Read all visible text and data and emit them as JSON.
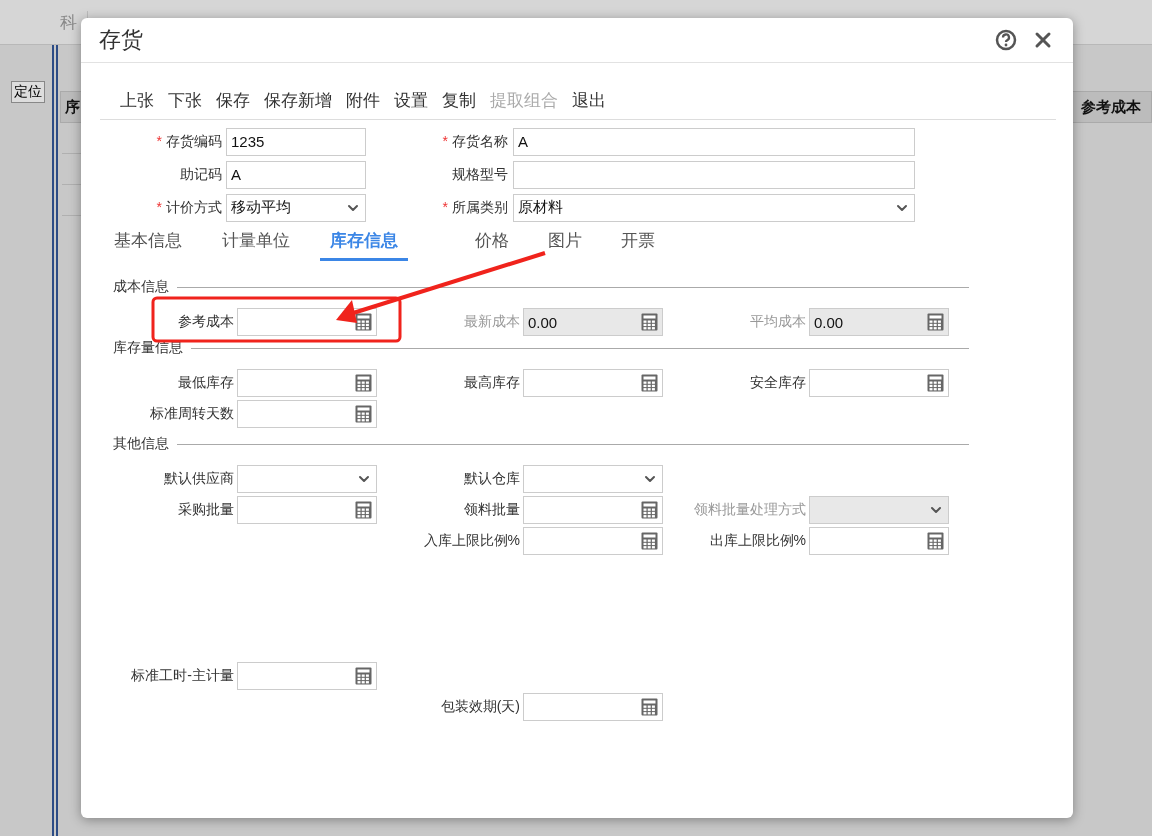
{
  "background_app": {
    "tabs": [
      "科"
    ],
    "locate_button": "定位",
    "table_columns": [
      "序",
      "参考成本"
    ]
  },
  "dialog": {
    "title": "存货",
    "toolbar": [
      {
        "label": "上张",
        "disabled": false
      },
      {
        "label": "下张",
        "disabled": false
      },
      {
        "label": "保存",
        "disabled": false
      },
      {
        "label": "保存新增",
        "disabled": false
      },
      {
        "label": "附件",
        "disabled": false
      },
      {
        "label": "设置",
        "disabled": false
      },
      {
        "label": "复制",
        "disabled": false
      },
      {
        "label": "提取组合",
        "disabled": true
      },
      {
        "label": "退出",
        "disabled": false
      }
    ],
    "header_fields": [
      [
        {
          "marker": "*",
          "label": "存货编码",
          "kind": "text",
          "value": "1235"
        },
        {
          "marker": "*",
          "label": "存货名称",
          "kind": "text",
          "value": "A"
        }
      ],
      [
        {
          "label": "助记码",
          "kind": "text",
          "value": "A"
        },
        {
          "label": "规格型号",
          "kind": "text"
        }
      ],
      [
        {
          "marker": "*",
          "label": "计价方式",
          "kind": "select",
          "value": "移动平均"
        },
        {
          "marker": "*",
          "label": "所属类别",
          "kind": "select",
          "value": "原材料"
        }
      ]
    ],
    "tabs": [
      {
        "label": "基本信息",
        "selected": false
      },
      {
        "label": "计量单位",
        "selected": false
      },
      {
        "label": "库存信息",
        "selected": true
      },
      {
        "label": "价格",
        "selected": false
      },
      {
        "label": "图片",
        "selected": false
      },
      {
        "label": "开票",
        "selected": false
      }
    ],
    "sections": [
      {
        "title": "成本信息",
        "rows": [
          [
            {
              "label": "参考成本",
              "kind": "number",
              "disabled": false
            },
            {
              "label": "最新成本",
              "kind": "number",
              "disabled": true,
              "value": "0.00"
            },
            {
              "label": "平均成本",
              "kind": "number",
              "disabled": true,
              "value": "0.00"
            }
          ]
        ]
      },
      {
        "title": "库存量信息",
        "rows": [
          [
            {
              "label": "最低库存",
              "kind": "number",
              "disabled": false
            },
            {
              "label": "最高库存",
              "kind": "number",
              "disabled": false
            },
            {
              "label": "安全库存",
              "kind": "number",
              "disabled": false
            }
          ],
          [
            {
              "label": "标准周转天数",
              "kind": "number",
              "disabled": false
            }
          ]
        ]
      },
      {
        "title": "其他信息",
        "rows": [
          [
            {
              "label": "默认供应商",
              "kind": "select",
              "disabled": false
            },
            {
              "label": "默认仓库",
              "kind": "select",
              "disabled": false
            }
          ],
          [
            {
              "label": "采购批量",
              "kind": "number",
              "disabled": false
            },
            {
              "label": "领料批量",
              "kind": "number",
              "disabled": false
            },
            {
              "label": "领料批量处理方式",
              "kind": "select",
              "disabled": true
            }
          ],
          [
            "",
            {
              "label": "入库上限比例%",
              "kind": "number",
              "disabled": false
            },
            {
              "label": "出库上限比例%",
              "kind": "number",
              "disabled": false
            }
          ]
        ],
        "lower_rows": [
          [
            {
              "label": "标准工时-主计量",
              "kind": "number",
              "disabled": false
            }
          ],
          [
            "",
            {
              "label": "包装效期(天)",
              "kind": "number",
              "disabled": false
            }
          ]
        ]
      }
    ]
  }
}
